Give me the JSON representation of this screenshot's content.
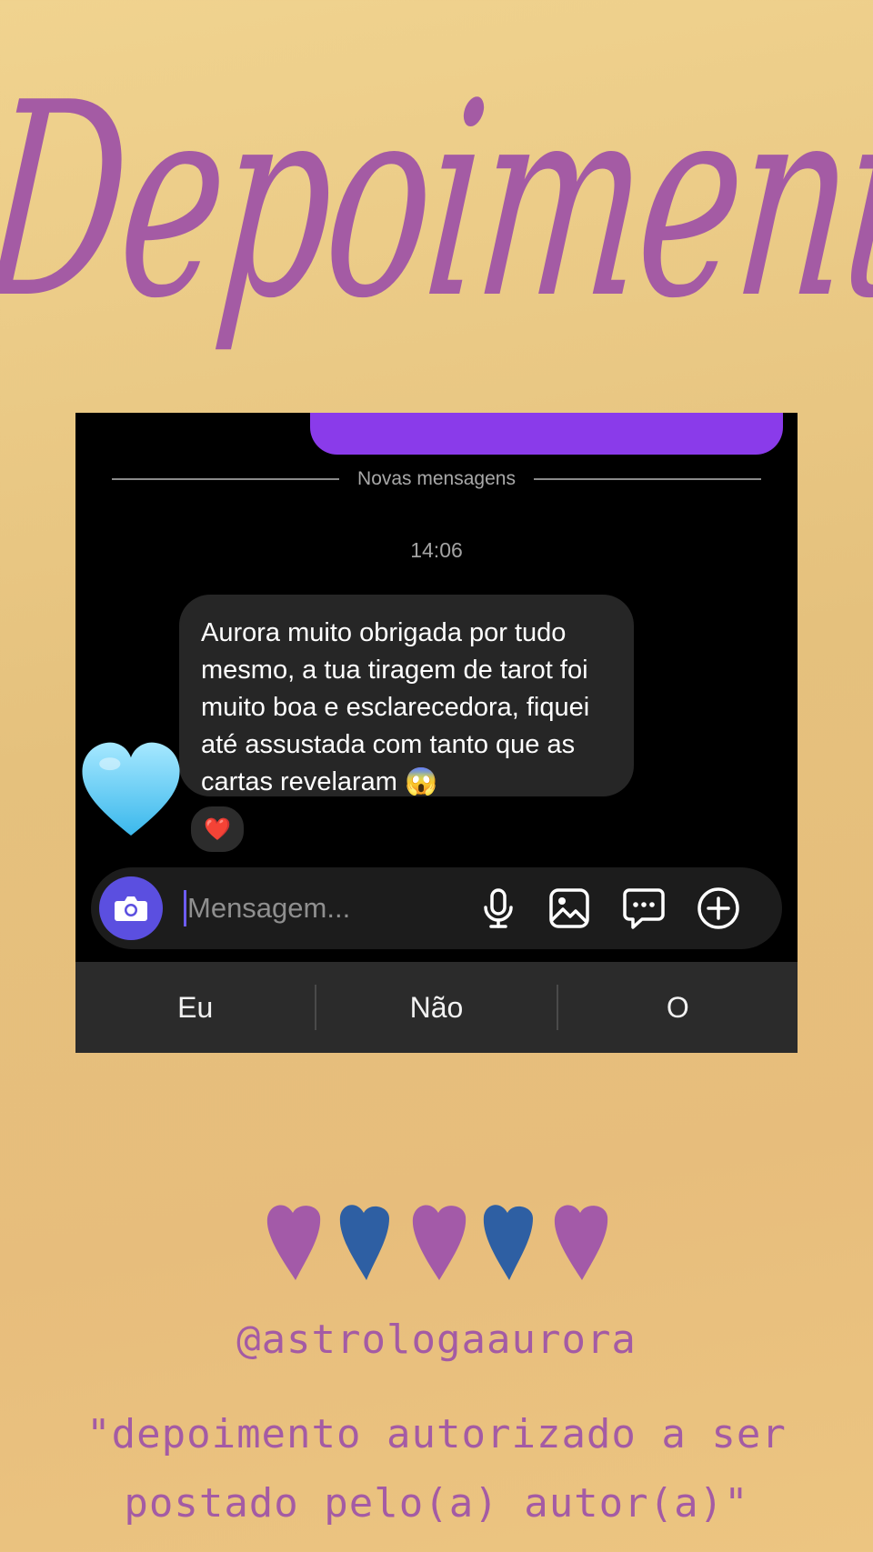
{
  "story": {
    "title": "Depoimentos",
    "handle": "@astrologaaurora",
    "note": "\"depoimento autorizado a ser postado pelo(a) autor(a)\""
  },
  "chat": {
    "new_messages_label": "Novas mensagens",
    "timestamp": "14:06",
    "message": "Aurora muito obrigada por tudo mesmo, a tua tiragem de tarot foi muito boa e esclarecedora, fiquei até assustada com tanto que as cartas revelaram 😱",
    "reaction": "❤️",
    "composer": {
      "placeholder": "Mensagem..."
    },
    "suggestions": [
      "Eu",
      "Não",
      "O"
    ]
  },
  "colors": {
    "accent_purple": "#a45ba4",
    "redaction": "#8a3bea",
    "camera_button": "#5b4fe0",
    "heart_blue": "#2e5fa3",
    "sticker_heart": "#7fd6f5"
  },
  "icons": [
    "camera-icon",
    "microphone-icon",
    "image-icon",
    "sticker-icon",
    "plus-circle-icon",
    "heart-icon"
  ]
}
